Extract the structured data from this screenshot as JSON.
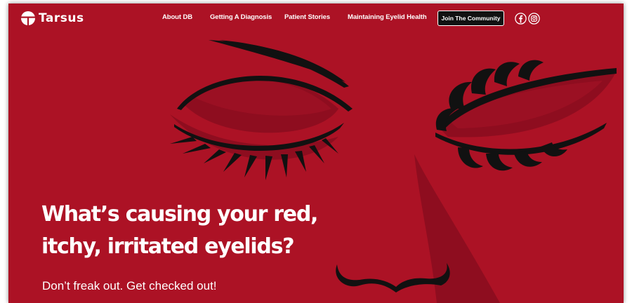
{
  "colors": {
    "background": "#ac1225",
    "deep_red": "#8e0d1f",
    "line": "#111111",
    "text": "#ffffff",
    "button_bg": "#111111"
  },
  "header": {
    "logo_text": "Tarsus",
    "logo_icon": "tarsus-logo-mark",
    "nav": [
      {
        "label": "About DB"
      },
      {
        "label": "Getting A Diagnosis"
      },
      {
        "label": "Patient Stories"
      },
      {
        "label": "Maintaining Eyelid Health"
      }
    ],
    "cta_label": "Join The Community",
    "social": [
      {
        "icon": "facebook-icon"
      },
      {
        "icon": "instagram-icon"
      }
    ]
  },
  "hero": {
    "heading_line1": "What’s causing your red,",
    "heading_line2": "itchy, irritated eyelids?",
    "subheading": "Don’t freak out. Get checked out!",
    "illustration": "closed-eyes-face-illustration"
  }
}
